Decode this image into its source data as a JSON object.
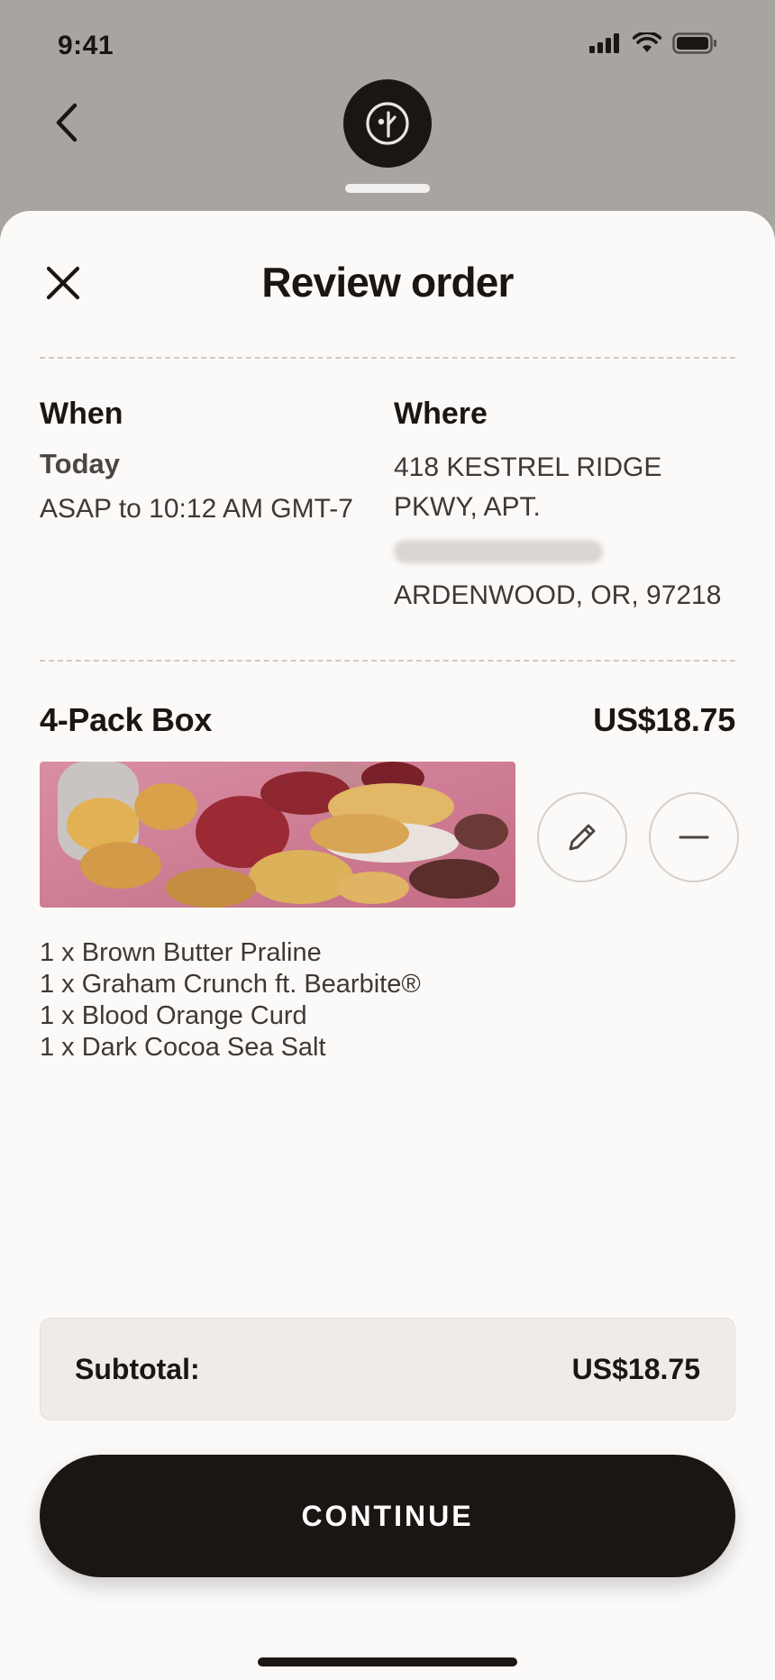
{
  "status_bar": {
    "time": "9:41"
  },
  "sheet": {
    "title": "Review order",
    "when": {
      "heading": "When",
      "day": "Today",
      "window": "ASAP to 10:12 AM GMT-7"
    },
    "where": {
      "heading": "Where",
      "address_line1": "418 KESTREL RIDGE",
      "address_line2": "PKWY, APT.",
      "address_line3": "ARDENWOOD, OR, 97218"
    },
    "product": {
      "name": "4-Pack Box",
      "price": "US$18.75",
      "items": [
        "1 x Brown Butter Praline",
        "1 x Graham Crunch ft. Bearbite®",
        "1 x Blood Orange Curd",
        "1 x Dark Cocoa Sea Salt"
      ]
    },
    "subtotal": {
      "label": "Subtotal:",
      "value": "US$18.75"
    },
    "continue_label": "CONTINUE"
  },
  "icons": [
    "chevron-left-icon",
    "brand-logo-icon",
    "close-icon",
    "pencil-icon",
    "minus-icon",
    "signal-icon",
    "wifi-icon",
    "battery-icon"
  ],
  "colors": {
    "primary": "#1b1614",
    "sheet_bg": "#fcfaf8",
    "backdrop": "#a8a49f",
    "subtotal_bg": "#efece8"
  }
}
